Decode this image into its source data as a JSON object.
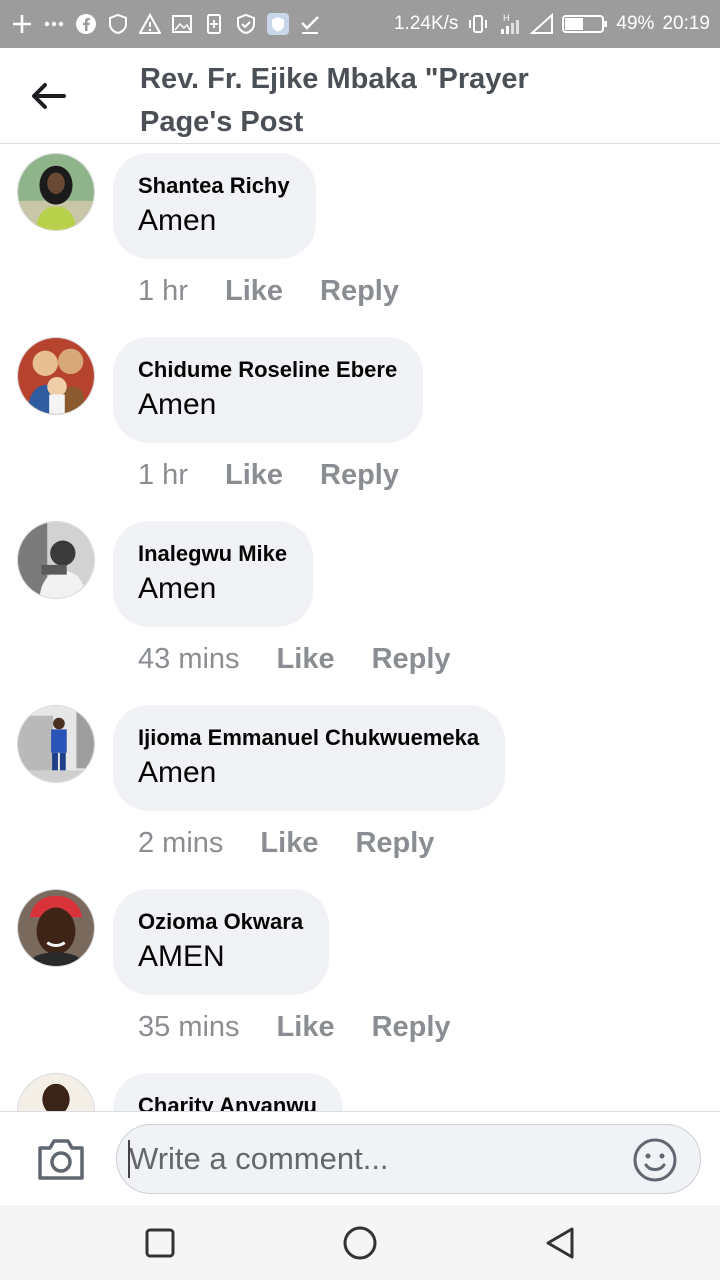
{
  "status_bar": {
    "network_speed": "1.24K/s",
    "battery_percent": "49%",
    "time": "20:19",
    "icons_left": [
      "plus-icon",
      "more-icon",
      "facebook-icon",
      "shield-icon",
      "warning-icon",
      "image-icon",
      "sim-icon",
      "shield-check-icon",
      "app-icon",
      "check-icon"
    ],
    "icons_right": [
      "vibrate-icon",
      "signal-h-icon",
      "signal-icon",
      "battery-icon"
    ]
  },
  "header": {
    "title": "Rev. Fr. Ejike Mbaka \"Prayer Page's Post",
    "back_icon": "arrow-left-icon"
  },
  "comments": [
    {
      "author": "Shantea Richy",
      "text": "Amen",
      "time": "1 hr",
      "like": "Like",
      "reply": "Reply"
    },
    {
      "author": "Chidume Roseline Ebere",
      "text": "Amen",
      "time": "1 hr",
      "like": "Like",
      "reply": "Reply"
    },
    {
      "author": "Inalegwu Mike",
      "text": "Amen",
      "time": "43 mins",
      "like": "Like",
      "reply": "Reply"
    },
    {
      "author": "Ijioma Emmanuel Chukwuemeka",
      "text": "Amen",
      "time": "2 mins",
      "like": "Like",
      "reply": "Reply"
    },
    {
      "author": "Ozioma Okwara",
      "text": "AMEN",
      "time": "35 mins",
      "like": "Like",
      "reply": "Reply"
    },
    {
      "author": "Charity Anyanwu",
      "text": "",
      "time": "",
      "like": "",
      "reply": ""
    }
  ],
  "composer": {
    "placeholder": "Write a comment...",
    "camera_icon": "camera-icon",
    "emoji_icon": "emoji-icon"
  },
  "nav_bar": {
    "icons": [
      "recents-square-icon",
      "home-circle-icon",
      "back-triangle-icon"
    ]
  },
  "colors": {
    "status_bar_bg": "#9c9c9c",
    "bubble_bg": "#f0f2f5",
    "meta_text": "#8a8d91",
    "title_text": "#4b4f56"
  }
}
